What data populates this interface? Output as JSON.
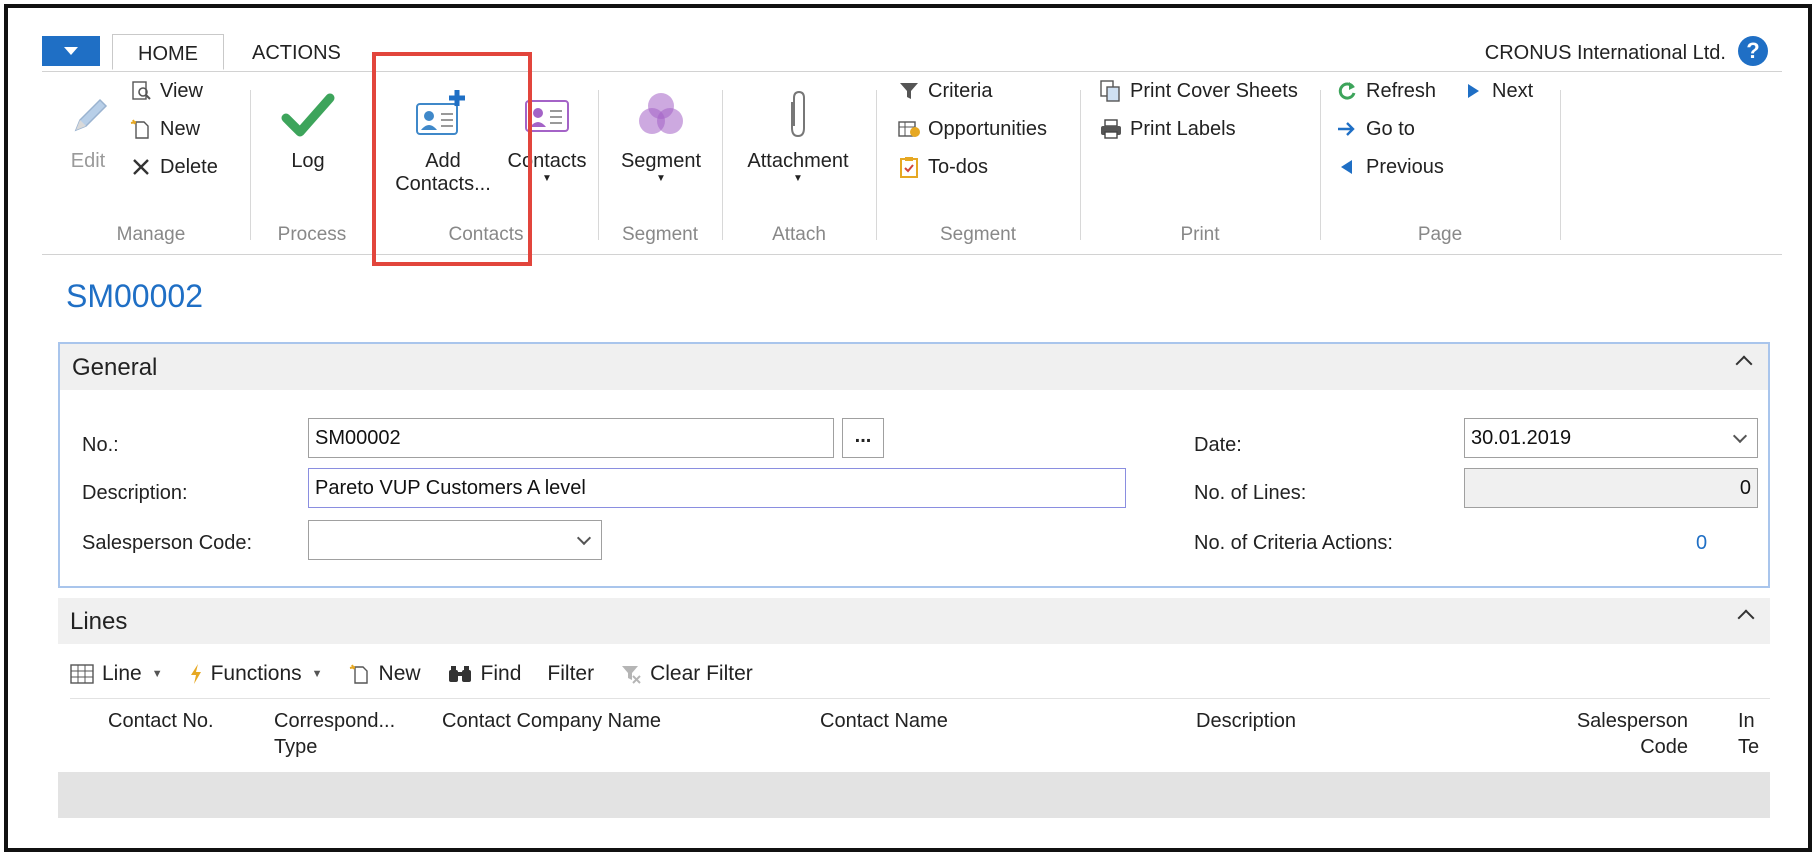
{
  "colors": {
    "accent": "#1f6fc5",
    "highlight": "#e2453c",
    "check": "#3da45b",
    "segment": "#a463c7"
  },
  "ribbon_tabs": {
    "home": "HOME",
    "actions": "ACTIONS"
  },
  "company": "CRONUS International Ltd.",
  "help_icon": "?",
  "manage": {
    "edit": "Edit",
    "view": "View",
    "new": "New",
    "delete": "Delete",
    "label": "Manage"
  },
  "process": {
    "log": "Log",
    "label": "Process"
  },
  "contacts": {
    "add_line1": "Add",
    "add_line2": "Contacts...",
    "contacts": "Contacts",
    "label": "Contacts"
  },
  "segment1": {
    "segment": "Segment",
    "label": "Segment"
  },
  "attach": {
    "attachment": "Attachment",
    "label": "Attach"
  },
  "segment2": {
    "criteria": "Criteria",
    "opportunities": "Opportunities",
    "todos": "To-dos",
    "label": "Segment"
  },
  "print": {
    "cover": "Print Cover Sheets",
    "labels": "Print Labels",
    "label": "Print"
  },
  "page": {
    "refresh": "Refresh",
    "next": "Next",
    "goto": "Go to",
    "previous": "Previous",
    "label": "Page"
  },
  "page_title": "SM00002",
  "general": {
    "title": "General",
    "no_label": "No.:",
    "no_value": "SM00002",
    "dots": "...",
    "desc_label": "Description:",
    "desc_value": "Pareto VUP Customers A level",
    "sales_label": "Salesperson Code:",
    "sales_value": "",
    "date_label": "Date:",
    "date_value": "30.01.2019",
    "lines_label": "No. of Lines:",
    "lines_value": "0",
    "criteria_label": "No. of Criteria Actions:",
    "criteria_value": "0"
  },
  "lines": {
    "title": "Lines",
    "toolbar": {
      "line": "Line",
      "functions": "Functions",
      "new": "New",
      "find": "Find",
      "filter": "Filter",
      "clear_filter": "Clear Filter"
    },
    "columns": [
      "Contact No.",
      "Correspond...",
      "Type",
      "Contact Company Name",
      "Contact Name",
      "Description",
      "Salesperson",
      "Code",
      "In",
      "Te"
    ]
  }
}
